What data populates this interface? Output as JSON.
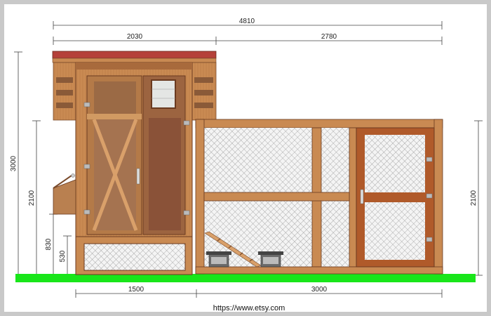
{
  "dimensions": {
    "total_width": "4810",
    "coop_width": "2030",
    "run_width": "2780",
    "total_height": "3000",
    "coop_height": "2100",
    "floor_height": "830",
    "base_height": "530",
    "run_height": "2100",
    "bottom_coop": "1500",
    "bottom_run": "3000"
  },
  "source_url": "https://www.etsy.com",
  "colors": {
    "ground": "#19e61a",
    "wood_light": "#c98a52",
    "wood_mid": "#a86a3c",
    "wood_dark": "#7a4a2a",
    "roof": "#b5413a",
    "mesh": "#dcdcdc"
  }
}
